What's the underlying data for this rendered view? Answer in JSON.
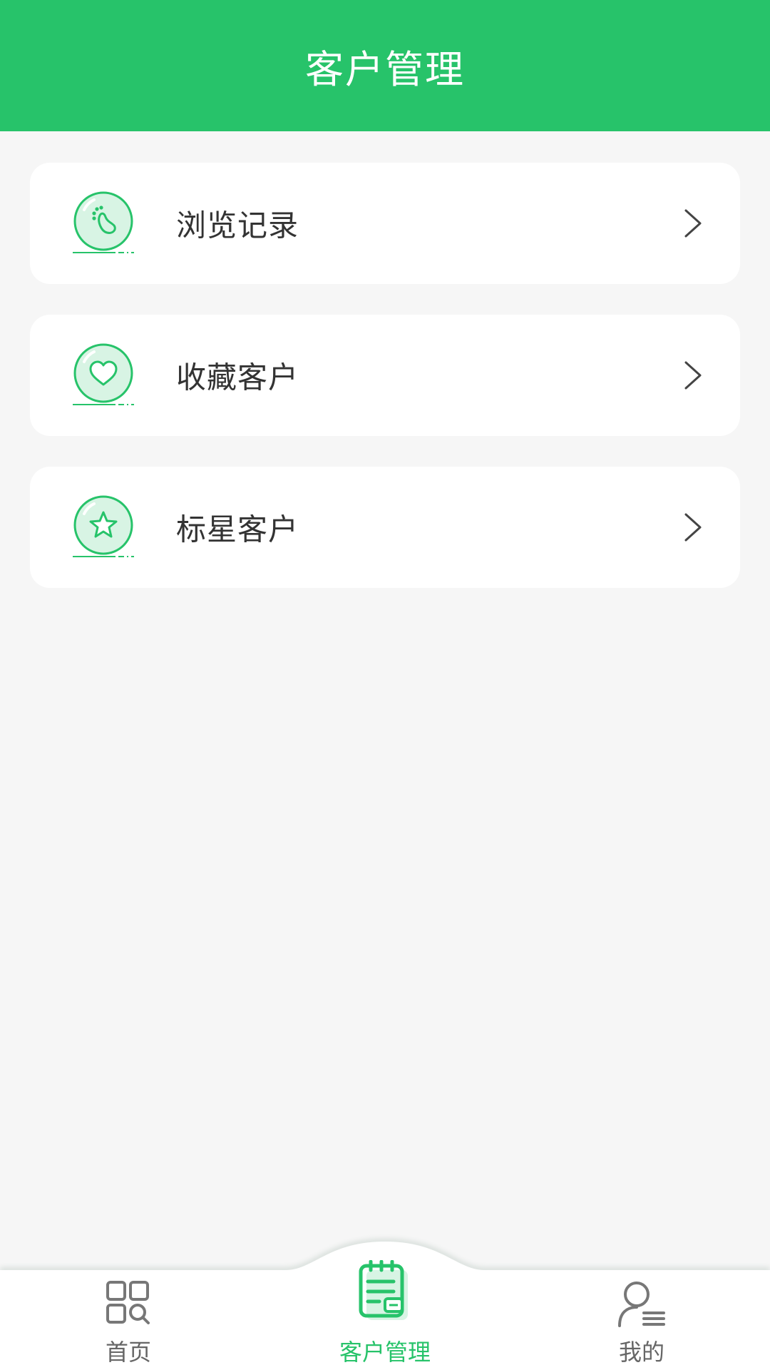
{
  "header": {
    "title": "客户管理"
  },
  "menu": [
    {
      "label": "浏览记录",
      "icon": "footprint-icon"
    },
    {
      "label": "收藏客户",
      "icon": "heart-icon"
    },
    {
      "label": "标星客户",
      "icon": "star-icon"
    }
  ],
  "bottom_nav": [
    {
      "label": "首页",
      "icon": "grid-search-icon",
      "active": false
    },
    {
      "label": "客户管理",
      "icon": "notebook-icon",
      "active": true
    },
    {
      "label": "我的",
      "icon": "user-list-icon",
      "active": false
    }
  ],
  "colors": {
    "primary": "#27c36a",
    "background": "#f6f6f6",
    "card": "#ffffff",
    "text": "#333333",
    "nav_inactive": "#666666"
  }
}
